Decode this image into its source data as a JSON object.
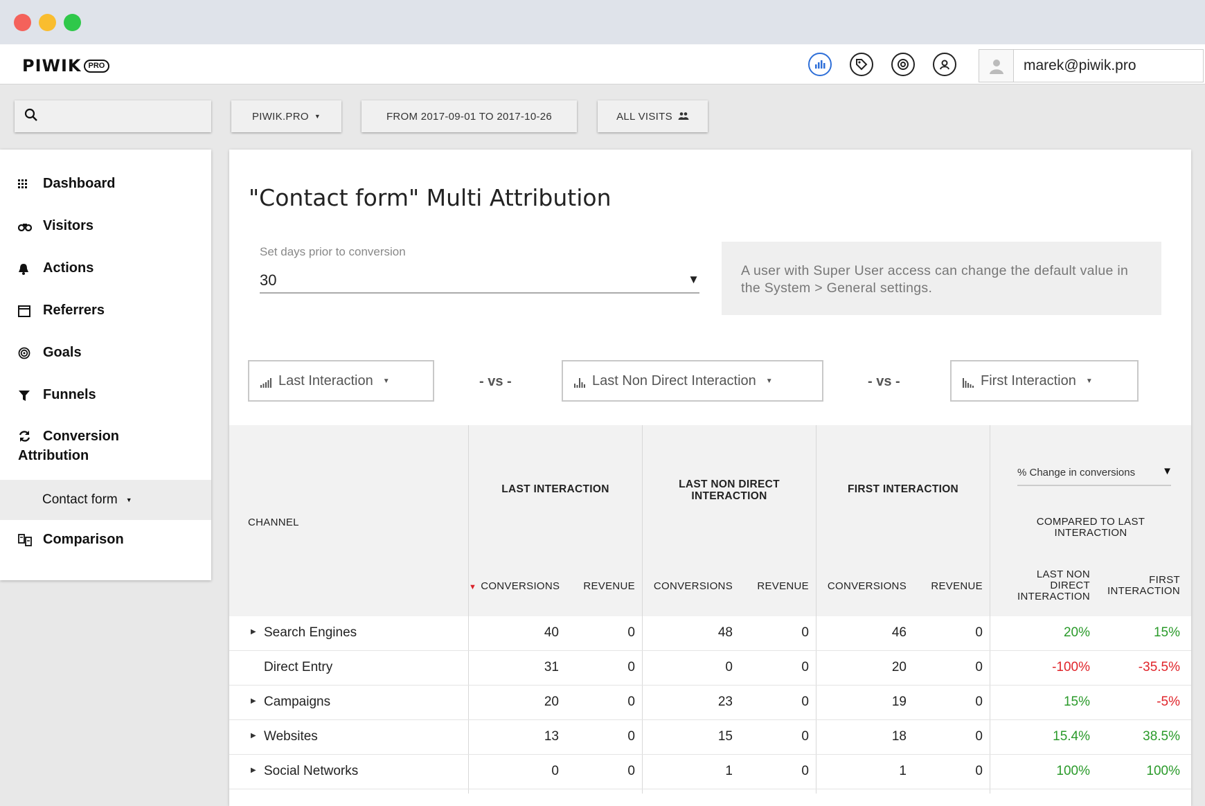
{
  "header": {
    "logo_word": "PIWIK",
    "logo_badge": "PRO",
    "user_email": "marek@piwik.pro"
  },
  "filters": {
    "site": "PIWIK.PRO",
    "date_range": "FROM 2017-09-01 TO 2017-10-26",
    "segment": "ALL VISITS"
  },
  "sidebar": {
    "items": [
      {
        "label": "Dashboard",
        "icon": "grid-icon"
      },
      {
        "label": "Visitors",
        "icon": "binoculars-icon"
      },
      {
        "label": "Actions",
        "icon": "bell-icon"
      },
      {
        "label": "Referrers",
        "icon": "window-icon"
      },
      {
        "label": "Goals",
        "icon": "target-icon"
      },
      {
        "label": "Funnels",
        "icon": "funnel-icon"
      },
      {
        "label": "Conversion Attribution",
        "icon": "refresh-icon"
      },
      {
        "label": "Contact form",
        "icon": "caret-down-icon"
      },
      {
        "label": "Comparison",
        "icon": "compare-icon"
      }
    ],
    "conversion_line1": "Conversion",
    "conversion_line2": "Attribution"
  },
  "main": {
    "title": "\"Contact form\" Multi Attribution",
    "days_label": "Set days prior to conversion",
    "days_value": "30",
    "notice": "A user with Super User access can change the default value in the System > General settings.",
    "models": [
      "Last Interaction",
      "Last Non Direct Interaction",
      "First Interaction"
    ],
    "vs_label": "- vs -"
  },
  "table": {
    "channel_header": "CHANNEL",
    "group_headers": [
      "LAST INTERACTION",
      "LAST NON DIRECT INTERACTION",
      "FIRST INTERACTION"
    ],
    "group_header_2_line1": "LAST NON DIRECT",
    "group_header_2_line2": "INTERACTION",
    "conversions_label": "CONVERSIONS",
    "revenue_label": "REVENUE",
    "pct_select": "% Change in conversions",
    "compared_line1": "COMPARED TO LAST",
    "compared_line2": "INTERACTION",
    "pct_col1_line1": "LAST NON",
    "pct_col1_line2": "DIRECT",
    "pct_col1_line3": "INTERACTION",
    "pct_col2_line1": "FIRST",
    "pct_col2_line2": "INTERACTION",
    "rows": [
      {
        "channel": "Search Engines",
        "expandable": true,
        "li_conv": "40",
        "li_rev": "0",
        "lnd_conv": "48",
        "lnd_rev": "0",
        "fi_conv": "46",
        "fi_rev": "0",
        "pct_lnd": "20%",
        "pct_fi": "15%"
      },
      {
        "channel": "Direct Entry",
        "expandable": false,
        "li_conv": "31",
        "li_rev": "0",
        "lnd_conv": "0",
        "lnd_rev": "0",
        "fi_conv": "20",
        "fi_rev": "0",
        "pct_lnd": "-100%",
        "pct_fi": "-35.5%"
      },
      {
        "channel": "Campaigns",
        "expandable": true,
        "li_conv": "20",
        "li_rev": "0",
        "lnd_conv": "23",
        "lnd_rev": "0",
        "fi_conv": "19",
        "fi_rev": "0",
        "pct_lnd": "15%",
        "pct_fi": "-5%"
      },
      {
        "channel": "Websites",
        "expandable": true,
        "li_conv": "13",
        "li_rev": "0",
        "lnd_conv": "15",
        "lnd_rev": "0",
        "fi_conv": "18",
        "fi_rev": "0",
        "pct_lnd": "15.4%",
        "pct_fi": "38.5%"
      },
      {
        "channel": "Social Networks",
        "expandable": true,
        "li_conv": "0",
        "li_rev": "0",
        "lnd_conv": "1",
        "lnd_rev": "0",
        "fi_conv": "1",
        "fi_rev": "0",
        "pct_lnd": "100%",
        "pct_fi": "100%"
      }
    ]
  },
  "colors": {
    "positive": "#2a9a2a",
    "negative": "#e0242a",
    "accent": "#2e6fd8"
  }
}
